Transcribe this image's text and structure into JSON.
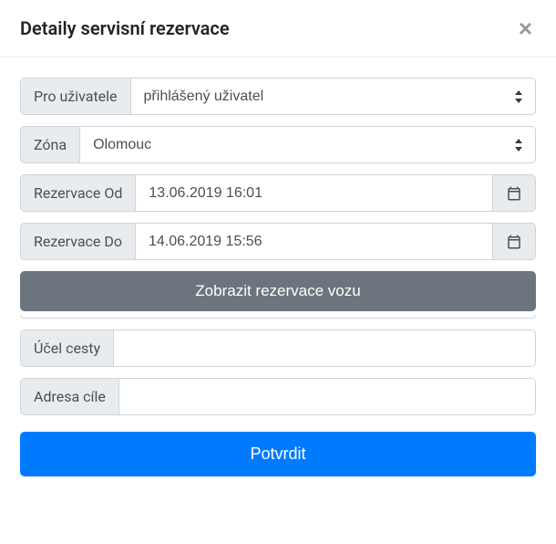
{
  "header": {
    "title": "Detaily servisní rezervace",
    "close_symbol": "×"
  },
  "fields": {
    "user": {
      "label": "Pro uživatele",
      "value": "přihlášený uživatel"
    },
    "zone": {
      "label": "Zóna",
      "value": "Olomouc"
    },
    "from": {
      "label": "Rezervace Od",
      "value": "13.06.2019 16:01"
    },
    "to": {
      "label": "Rezervace Do",
      "value": "14.06.2019 15:56"
    },
    "purpose": {
      "label": "Účel cesty",
      "value": ""
    },
    "destination": {
      "label": "Adresa cíle",
      "value": ""
    }
  },
  "buttons": {
    "show_reservations": "Zobrazit rezervace vozu",
    "confirm": "Potvrdit"
  }
}
